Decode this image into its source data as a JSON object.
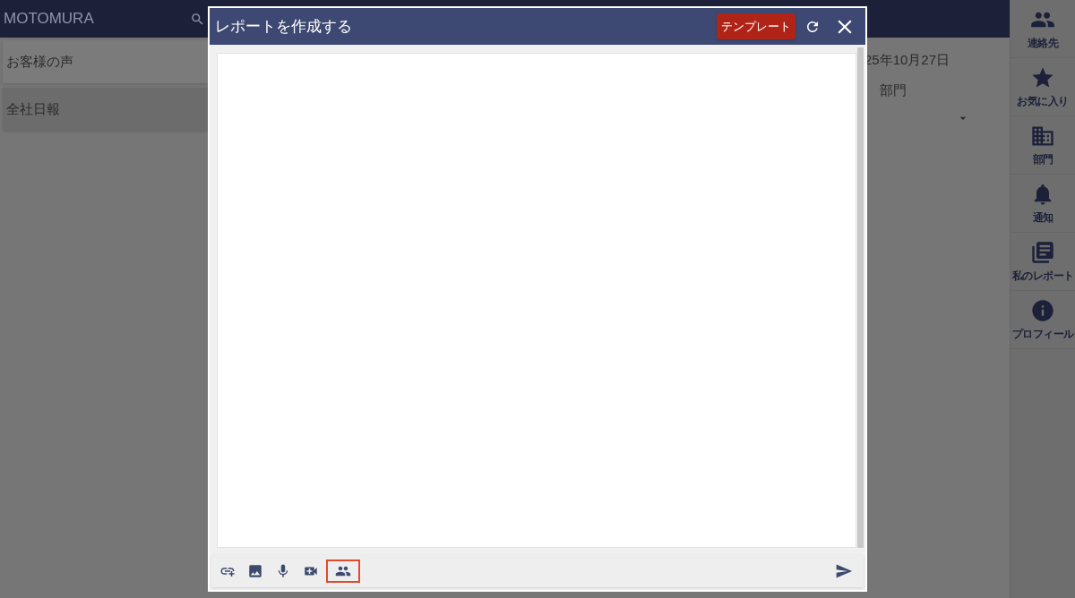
{
  "app": {
    "title": "MOTOMURA"
  },
  "channels": [
    {
      "label": "お客様の声",
      "selected": false
    },
    {
      "label": "全社日報",
      "selected": true
    }
  ],
  "date": "25年10月27日",
  "department_label": "部門",
  "sidebar": {
    "items": [
      {
        "kind": "contacts",
        "label": "連絡先"
      },
      {
        "kind": "favorites",
        "label": "お気に入り"
      },
      {
        "kind": "departments",
        "label": "部門"
      },
      {
        "kind": "notifications",
        "label": "通知"
      },
      {
        "kind": "reports",
        "label": "私のレポート"
      },
      {
        "kind": "profile",
        "label": "プロフィール"
      }
    ]
  },
  "dialog": {
    "title": "レポートを作成する",
    "template_button": "テンプレート",
    "toolbar": [
      {
        "kind": "link",
        "selected": false
      },
      {
        "kind": "image",
        "selected": false
      },
      {
        "kind": "mic",
        "selected": false
      },
      {
        "kind": "video",
        "selected": false
      },
      {
        "kind": "people",
        "selected": true
      }
    ]
  }
}
